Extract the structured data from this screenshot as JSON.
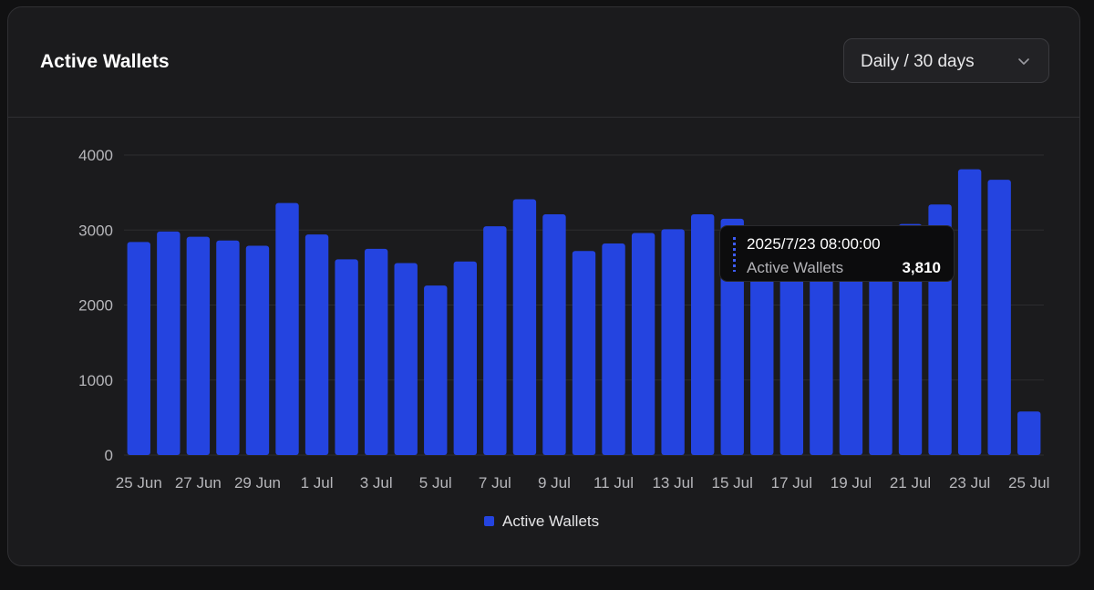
{
  "header": {
    "title": "Active Wallets",
    "range_select": "Daily / 30 days",
    "dropdown_icon": "chevron-down-icon"
  },
  "colors": {
    "bar": "#2444e0",
    "grid": "#2c2c2f",
    "axis_text": "#b6b6ba",
    "card_bg": "#1b1b1d"
  },
  "tooltip": {
    "date": "2025/7/23 08:00:00",
    "series": "Active Wallets",
    "value": "3,810"
  },
  "legend": {
    "label": "Active Wallets"
  },
  "chart_data": {
    "type": "bar",
    "title": "Active Wallets",
    "xlabel": "",
    "ylabel": "",
    "ylim": [
      0,
      4000
    ],
    "yticks": [
      0,
      1000,
      2000,
      3000,
      4000
    ],
    "grid": true,
    "legend_position": "bottom-center",
    "categories": [
      "25 Jun",
      "26 Jun",
      "27 Jun",
      "28 Jun",
      "29 Jun",
      "30 Jun",
      "1 Jul",
      "2 Jul",
      "3 Jul",
      "4 Jul",
      "5 Jul",
      "6 Jul",
      "7 Jul",
      "8 Jul",
      "9 Jul",
      "10 Jul",
      "11 Jul",
      "12 Jul",
      "13 Jul",
      "14 Jul",
      "15 Jul",
      "16 Jul",
      "17 Jul",
      "18 Jul",
      "19 Jul",
      "20 Jul",
      "21 Jul",
      "22 Jul",
      "23 Jul",
      "24 Jul",
      "25 Jul"
    ],
    "xtick_labels": [
      "25 Jun",
      "27 Jun",
      "29 Jun",
      "1 Jul",
      "3 Jul",
      "5 Jul",
      "7 Jul",
      "9 Jul",
      "11 Jul",
      "13 Jul",
      "15 Jul",
      "17 Jul",
      "19 Jul",
      "21 Jul",
      "23 Jul",
      "25 Jul"
    ],
    "series": [
      {
        "name": "Active Wallets",
        "values": [
          2840,
          2980,
          2910,
          2860,
          2790,
          3360,
          2940,
          2610,
          2750,
          2560,
          2260,
          2580,
          3050,
          3410,
          3210,
          2720,
          2820,
          2960,
          3010,
          3210,
          3150,
          2700,
          2690,
          2780,
          2850,
          2730,
          3080,
          3340,
          3810,
          3670,
          580
        ]
      }
    ]
  }
}
